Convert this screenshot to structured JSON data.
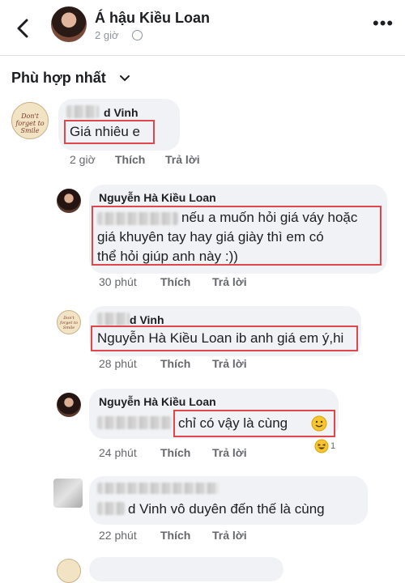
{
  "header": {
    "page_name": "Á hậu Kiều Loan",
    "time": "2 giờ",
    "more": "•••"
  },
  "sort": {
    "label": "Phù hợp nhất"
  },
  "comments": [
    {
      "author": "d Vinh",
      "text": "Giá nhiêu e",
      "time": "2 giờ",
      "like": "Thích",
      "reply": "Trả lời",
      "avatar_text": "Don't forget to Smile"
    },
    {
      "author": "Nguyễn Hà Kiều Loan",
      "text_line1": "nếu a muốn hỏi giá váy hoặc",
      "text_line2": "giá khuyên tay hay giá giày thì em có",
      "text_line3": "thể hỏi giúp anh này :))",
      "time": "30 phút",
      "like": "Thích",
      "reply": "Trả lời"
    },
    {
      "author": "d Vinh",
      "text": "Nguyễn Hà Kiều Loan ib anh giá em ý,hi",
      "time": "28 phút",
      "like": "Thích",
      "reply": "Trả lời",
      "avatar_text": "Don't forget to Smile"
    },
    {
      "author": "Nguyễn Hà Kiều Loan",
      "text": "chỉ có vậy là cùng",
      "time": "24 phút",
      "like": "Thích",
      "reply": "Trả lời",
      "reaction_count": "1"
    },
    {
      "author": "",
      "text": "d Vinh vô duyên đến thế là cùng",
      "time": "22 phút",
      "like": "Thích",
      "reply": "Trả lời"
    }
  ],
  "colors": {
    "highlight_box": "#e0474c",
    "bubble": "#f0f2f5",
    "meta_text": "#65676b"
  }
}
